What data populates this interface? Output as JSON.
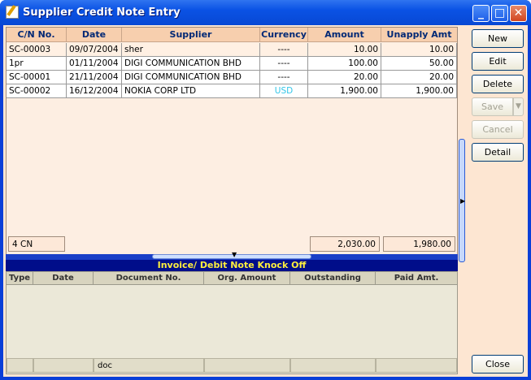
{
  "window": {
    "title": "Supplier Credit Note Entry"
  },
  "grid": {
    "columns": [
      "C/N No.",
      "Date",
      "Supplier",
      "Currency",
      "Amount",
      "Unapply Amt"
    ],
    "rows": [
      {
        "cn_no": "SC-00003",
        "date": "09/07/2004",
        "supplier": "sher",
        "currency": "----",
        "amount": "10.00",
        "unapply": "10.00"
      },
      {
        "cn_no": "1pr",
        "date": "01/11/2004",
        "supplier": "DIGI COMMUNICATION BHD",
        "currency": "----",
        "amount": "100.00",
        "unapply": "50.00"
      },
      {
        "cn_no": "SC-00001",
        "date": "21/11/2004",
        "supplier": "DIGI COMMUNICATION BHD",
        "currency": "----",
        "amount": "20.00",
        "unapply": "20.00"
      },
      {
        "cn_no": "SC-00002",
        "date": "16/12/2004",
        "supplier": "NOKIA CORP LTD",
        "currency": "USD",
        "amount": "1,900.00",
        "unapply": "1,900.00"
      }
    ],
    "footer": {
      "count": "4 CN",
      "total_amount": "2,030.00",
      "total_unapply": "1,980.00"
    },
    "currency_highlight_color": "#33c6e8"
  },
  "knockoff": {
    "title": "Invoice/ Debit Note Knock Off",
    "columns": [
      "Type",
      "Date",
      "Document No.",
      "Org. Amount",
      "Outstanding",
      "Paid Amt."
    ],
    "footer": {
      "doc_label": "doc"
    }
  },
  "buttons": {
    "new": "New",
    "edit": "Edit",
    "delete": "Delete",
    "save": "Save",
    "cancel": "Cancel",
    "detail": "Detail",
    "close": "Close"
  }
}
